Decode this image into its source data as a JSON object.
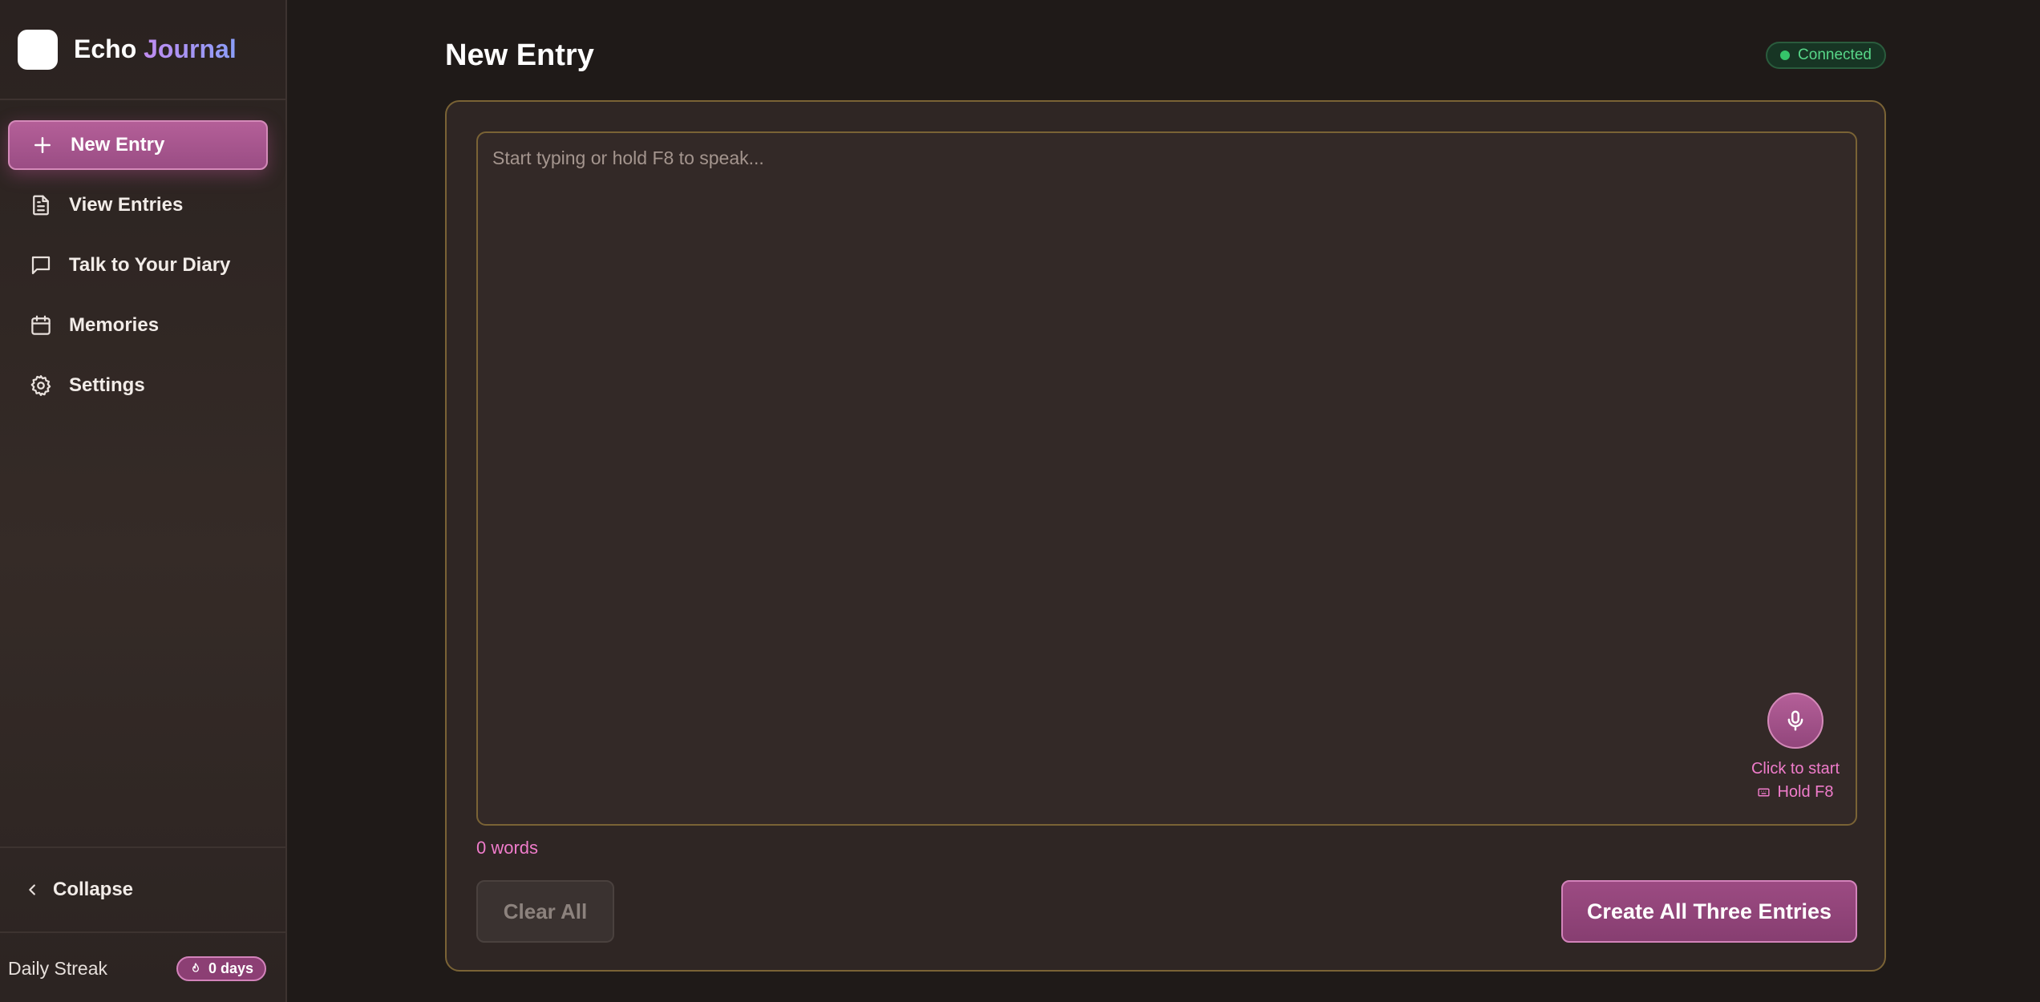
{
  "brand": {
    "name_part1": "Echo",
    "name_part2": "Journal"
  },
  "nav": [
    {
      "label": "New Entry",
      "icon": "plus-icon",
      "active": true
    },
    {
      "label": "View Entries",
      "icon": "document-icon"
    },
    {
      "label": "Talk to Your Diary",
      "icon": "chat-bubble-icon"
    },
    {
      "label": "Memories",
      "icon": "calendar-icon"
    },
    {
      "label": "Settings",
      "icon": "gear-icon"
    }
  ],
  "sidebar_footer": {
    "collapse_label": "Collapse",
    "streak_label": "Daily Streak",
    "streak_value": "0 days"
  },
  "main": {
    "title": "New Entry",
    "status": "Connected",
    "editor_placeholder": "Start typing or hold F8 to speak...",
    "mic_hint": "Click to start",
    "mic_key_hint": "Hold F8",
    "word_count": "0 words",
    "clear_label": "Clear All",
    "create_label": "Create All Three Entries"
  },
  "colors": {
    "accent_pink": "#b45f98",
    "hint_pink": "#f07ccb",
    "status_green": "#35c46a",
    "border_gold": "#7a6335"
  }
}
